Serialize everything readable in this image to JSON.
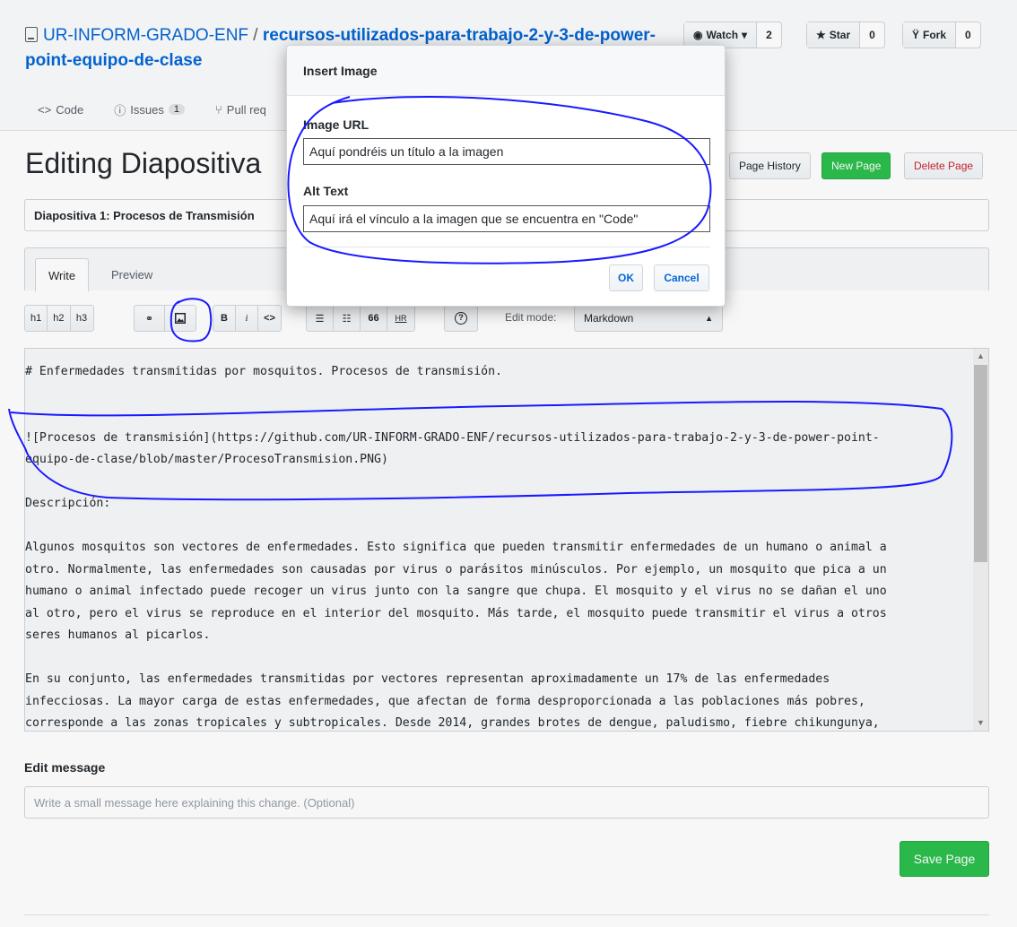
{
  "repo": {
    "owner": "UR-INFORM-GRADO-ENF",
    "separator": " / ",
    "name": "recursos-utilizados-para-trabajo-2-y-3-de-power-point-equipo-de-clase"
  },
  "social": {
    "watch_label": "Watch",
    "watch_count": "2",
    "star_label": "Star",
    "star_count": "0",
    "fork_label": "Fork",
    "fork_count": "0"
  },
  "nav": {
    "code": "Code",
    "issues": "Issues",
    "issues_count": "1",
    "pulls": "Pull req"
  },
  "page": {
    "heading": "Editing Diapositiva",
    "history": "Page History",
    "new_page": "New Page",
    "delete_page": "Delete Page",
    "title_value": "Diapositiva 1: Procesos de Transmisión"
  },
  "tabs": {
    "write": "Write",
    "preview": "Preview"
  },
  "toolbar": {
    "h1": "h1",
    "h2": "h2",
    "h3": "h3",
    "bold": "B",
    "italic": "i",
    "code": "<>",
    "quote": "66",
    "hr": "HR",
    "help": "?",
    "edit_mode_label": "Edit mode:",
    "edit_mode_value": "Markdown"
  },
  "editor": {
    "lines": [
      "# Enfermedades transmitidas por mosquitos. Procesos de transmisión.",
      "",
      "",
      "![Procesos de transmisión](https://github.com/UR-INFORM-GRADO-ENF/recursos-utilizados-para-trabajo-2-y-3-de-power-point-",
      "equipo-de-clase/blob/master/ProcesoTransmision.PNG)",
      "",
      "Descripción:",
      "",
      "Algunos mosquitos son vectores de enfermedades. Esto significa que pueden transmitir enfermedades de un humano o animal a",
      "otro. Normalmente, las enfermedades son causadas por virus o parásitos minúsculos. Por ejemplo, un mosquito que pica a un",
      "humano o animal infectado puede recoger un virus junto con la sangre que chupa. El mosquito y el virus no se dañan el uno",
      "al otro, pero el virus se reproduce en el interior del mosquito. Más tarde, el mosquito puede transmitir el virus a otros",
      "seres humanos al picarlos.",
      "",
      "En su conjunto, las enfermedades transmitidas por vectores representan aproximadamente un 17% de las enfermedades",
      "infecciosas. La mayor carga de estas enfermedades, que afectan de forma desproporcionada a las poblaciones más pobres,",
      "corresponde a las zonas tropicales y subtropicales. Desde 2014, grandes brotes de dengue, paludismo, fiebre chikungunya,"
    ]
  },
  "edit_message": {
    "label": "Edit message",
    "placeholder": "Write a small message here explaining this change. (Optional)"
  },
  "save_label": "Save Page",
  "modal": {
    "title": "Insert Image",
    "url_label": "Image URL",
    "url_value": "Aquí pondréis un título a la imagen",
    "alt_label": "Alt Text",
    "alt_value": "Aquí irá el vínculo a la imagen que se encuentra en \"Code\"",
    "ok": "OK",
    "cancel": "Cancel"
  },
  "colors": {
    "link": "#0366d6",
    "green": "#2cbe4e",
    "danger": "#cb2431",
    "annotation": "#1a1aff"
  }
}
